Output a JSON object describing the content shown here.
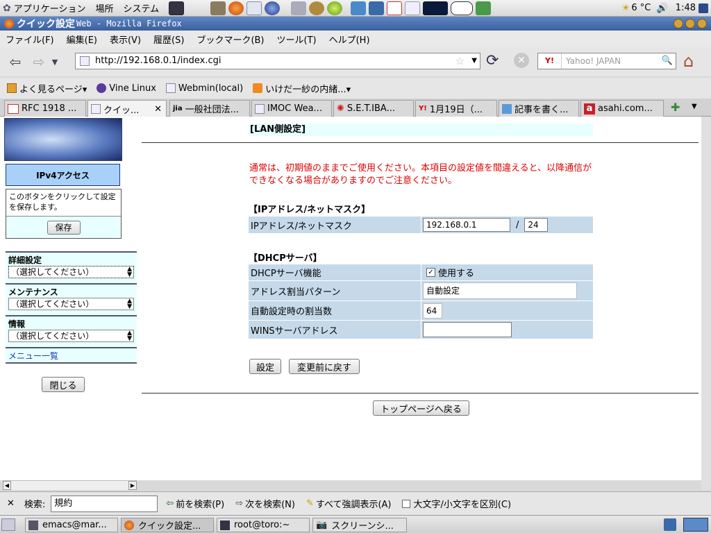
{
  "panel": {
    "menus": [
      "アプリケーション",
      "場所",
      "システム"
    ],
    "temp": "6 °C",
    "clock": "1:48"
  },
  "window": {
    "title_main": "クイック設定",
    "title_rest": "Web - Mozilla Firefox"
  },
  "menubar": [
    "ファイル(F)",
    "編集(E)",
    "表示(V)",
    "履歴(S)",
    "ブックマーク(B)",
    "ツール(T)",
    "ヘルプ(H)"
  ],
  "nav": {
    "url": "http://192.168.0.1/index.cgi",
    "search_placeholder": "Yahoo! JAPAN",
    "search_engine": "Y!"
  },
  "bookmarks": [
    "よく見るページ▾",
    "Vine Linux",
    "Webmin(local)",
    "いけだ一紗の内緒...▾"
  ],
  "tabs": [
    "RFC 1918 ...",
    "クイッ...",
    "一般社団法...",
    "IMOC Wea...",
    "S.E.T.IBA...",
    "1月19日（...",
    "記事を書く...",
    "asahi.com..."
  ],
  "sidebar": {
    "access_label": "IPv4アクセス",
    "save_note": "このボタンをクリックして設定を保存します。",
    "save_button": "保存",
    "sections": [
      {
        "label": "詳細設定",
        "select": "（選択してください）"
      },
      {
        "label": "メンテナンス",
        "select": "（選択してください）"
      },
      {
        "label": "情報",
        "select": "（選択してください）"
      }
    ],
    "menu_link": "メニュー一覧",
    "close_button": "閉じる"
  },
  "main": {
    "page_title": "[LAN側設定]",
    "warning": "通常は、初期値のままでご使用ください。本項目の設定値を間違えると、以降通信ができなくなる場合がありますのでご注意ください。",
    "ip_section": "【IPアドレス/ネットマスク】",
    "ip_label": "IPアドレス/ネットマスク",
    "ip_value": "192.168.0.1",
    "slash": "/",
    "mask_value": "24",
    "dhcp_section": "【DHCPサーバ】",
    "dhcp_rows": [
      {
        "label": "DHCPサーバ機能",
        "value": "使用する"
      },
      {
        "label": "アドレス割当パターン",
        "value": "自動設定"
      },
      {
        "label": "自動設定時の割当数",
        "value": "64"
      },
      {
        "label": "WINSサーバアドレス",
        "value": ""
      }
    ],
    "set_button": "設定",
    "revert_button": "変更前に戻す",
    "top_button": "トップページへ戻る"
  },
  "findbar": {
    "label": "検索:",
    "value": "規約",
    "prev": "前を検索(P)",
    "next": "次を検索(N)",
    "highlight": "すべて強調表示(A)",
    "matchcase": "大文字/小文字を区別(C)"
  },
  "taskbar": [
    "emacs@mar...",
    "クイック設定...",
    "root@toro:~",
    "スクリーンシ..."
  ]
}
